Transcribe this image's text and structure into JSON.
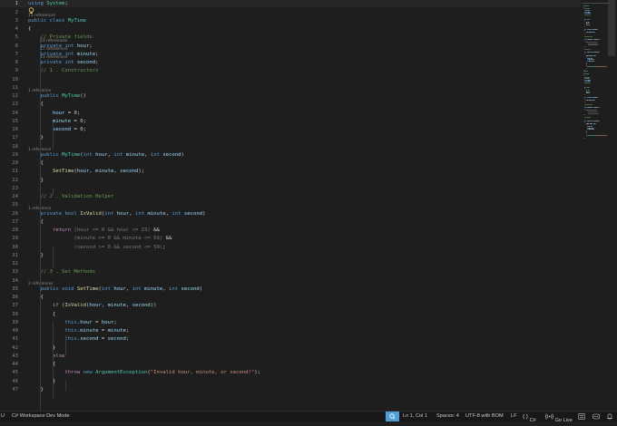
{
  "editor": {
    "lines": [
      {
        "n": "1",
        "ref": "",
        "tokens": [
          [
            "kw",
            "using "
          ],
          [
            "ty",
            "System"
          ],
          [
            "pl",
            ";"
          ]
        ]
      },
      {
        "n": "2",
        "ref": "11 references",
        "tokens": []
      },
      {
        "n": "3",
        "ref": "",
        "tokens": [
          [
            "kw",
            "public "
          ],
          [
            "kw",
            "class "
          ],
          [
            "ty",
            "MyTime"
          ]
        ]
      },
      {
        "n": "4",
        "ref": "",
        "tokens": [
          [
            "pl",
            "{"
          ]
        ]
      },
      {
        "n": "5",
        "ref": "23 references",
        "tokens": [
          [
            "pl",
            "    "
          ],
          [
            "cm",
            "// Private fields"
          ]
        ]
      },
      {
        "n": "6",
        "ref": "17 references",
        "tokens": [
          [
            "pl",
            "    "
          ],
          [
            "kw",
            "private "
          ],
          [
            "kw",
            "int "
          ],
          [
            "id",
            "hour"
          ],
          [
            "pl",
            ";"
          ]
        ]
      },
      {
        "n": "7",
        "ref": "11 references",
        "tokens": [
          [
            "pl",
            "    "
          ],
          [
            "kw",
            "private "
          ],
          [
            "kw",
            "int "
          ],
          [
            "id",
            "minute"
          ],
          [
            "pl",
            ";"
          ]
        ]
      },
      {
        "n": "8",
        "ref": "",
        "tokens": [
          [
            "pl",
            "    "
          ],
          [
            "kw",
            "private "
          ],
          [
            "kw",
            "int "
          ],
          [
            "id",
            "second"
          ],
          [
            "pl",
            ";"
          ]
        ]
      },
      {
        "n": "9",
        "ref": "",
        "tokens": [
          [
            "pl",
            "    "
          ],
          [
            "cm",
            "// 1 . Constructors"
          ]
        ]
      },
      {
        "n": "10",
        "ref": "",
        "tokens": []
      },
      {
        "n": "11",
        "ref": "1 reference",
        "tokens": []
      },
      {
        "n": "12",
        "ref": "",
        "tokens": [
          [
            "pl",
            "    "
          ],
          [
            "kw",
            "public "
          ],
          [
            "ty",
            "MyTime"
          ],
          [
            "pl",
            "()"
          ]
        ]
      },
      {
        "n": "13",
        "ref": "",
        "tokens": [
          [
            "pl",
            "    {"
          ]
        ]
      },
      {
        "n": "14",
        "ref": "",
        "tokens": [
          [
            "pl",
            "        "
          ],
          [
            "id",
            "hour"
          ],
          [
            "pl",
            " = "
          ],
          [
            "num",
            "0"
          ],
          [
            "pl",
            ";"
          ]
        ]
      },
      {
        "n": "15",
        "ref": "",
        "tokens": [
          [
            "pl",
            "        "
          ],
          [
            "id",
            "minute"
          ],
          [
            "pl",
            " = "
          ],
          [
            "num",
            "0"
          ],
          [
            "pl",
            ";"
          ]
        ]
      },
      {
        "n": "16",
        "ref": "",
        "tokens": [
          [
            "pl",
            "        "
          ],
          [
            "id",
            "second"
          ],
          [
            "pl",
            " = "
          ],
          [
            "num",
            "0"
          ],
          [
            "pl",
            ";"
          ]
        ]
      },
      {
        "n": "17",
        "ref": "",
        "tokens": [
          [
            "pl",
            "    }"
          ]
        ]
      },
      {
        "n": "18",
        "ref": "1 reference",
        "tokens": []
      },
      {
        "n": "19",
        "ref": "",
        "tokens": [
          [
            "pl",
            "    "
          ],
          [
            "kw",
            "public "
          ],
          [
            "ty",
            "MyTime"
          ],
          [
            "pl",
            "("
          ],
          [
            "kw",
            "int "
          ],
          [
            "id",
            "hour"
          ],
          [
            "pl",
            ", "
          ],
          [
            "kw",
            "int "
          ],
          [
            "id",
            "minute"
          ],
          [
            "pl",
            ", "
          ],
          [
            "kw",
            "int "
          ],
          [
            "id",
            "second"
          ],
          [
            "pl",
            ")"
          ]
        ]
      },
      {
        "n": "20",
        "ref": "",
        "tokens": [
          [
            "pl",
            "    {"
          ]
        ]
      },
      {
        "n": "21",
        "ref": "",
        "tokens": [
          [
            "pl",
            "        "
          ],
          [
            "fn",
            "SetTime"
          ],
          [
            "pl",
            "("
          ],
          [
            "id",
            "hour"
          ],
          [
            "pl",
            ", "
          ],
          [
            "id",
            "minute"
          ],
          [
            "pl",
            ", "
          ],
          [
            "id",
            "second"
          ],
          [
            "pl",
            ");"
          ]
        ]
      },
      {
        "n": "22",
        "ref": "",
        "tokens": [
          [
            "pl",
            "    }"
          ]
        ]
      },
      {
        "n": "23",
        "ref": "",
        "tokens": []
      },
      {
        "n": "24",
        "ref": "",
        "tokens": [
          [
            "pl",
            "    "
          ],
          [
            "cm",
            "// 2 . Validation Helper"
          ]
        ]
      },
      {
        "n": "25",
        "ref": "1 reference",
        "tokens": []
      },
      {
        "n": "26",
        "ref": "",
        "tokens": [
          [
            "pl",
            "    "
          ],
          [
            "kw",
            "private "
          ],
          [
            "kw",
            "bool "
          ],
          [
            "fn",
            "IsValid"
          ],
          [
            "pl",
            "("
          ],
          [
            "kw",
            "int "
          ],
          [
            "id",
            "hour"
          ],
          [
            "pl",
            ", "
          ],
          [
            "kw",
            "int "
          ],
          [
            "id",
            "minute"
          ],
          [
            "pl",
            ", "
          ],
          [
            "kw",
            "int "
          ],
          [
            "id",
            "second"
          ],
          [
            "pl",
            ")"
          ]
        ]
      },
      {
        "n": "27",
        "ref": "",
        "tokens": [
          [
            "pl",
            "    {"
          ]
        ]
      },
      {
        "n": "28",
        "ref": "",
        "tokens": [
          [
            "pl",
            "        "
          ],
          [
            "ctl",
            "return "
          ],
          [
            "dim",
            "(hour >= 0 && hour <= 23)"
          ],
          [
            "pl",
            " &&"
          ]
        ]
      },
      {
        "n": "29",
        "ref": "",
        "tokens": [
          [
            "pl",
            "               "
          ],
          [
            "dim",
            "(minute >= 0 && minute <= 59)"
          ],
          [
            "pl",
            " &&"
          ]
        ]
      },
      {
        "n": "30",
        "ref": "",
        "tokens": [
          [
            "pl",
            "               "
          ],
          [
            "dim",
            "(second >= 0 && second <= 59)"
          ],
          [
            "pl",
            ";"
          ]
        ]
      },
      {
        "n": "31",
        "ref": "",
        "tokens": [
          [
            "pl",
            "    }"
          ]
        ]
      },
      {
        "n": "32",
        "ref": "",
        "tokens": []
      },
      {
        "n": "33",
        "ref": "",
        "tokens": [
          [
            "pl",
            "    "
          ],
          [
            "cm",
            "// 3 . Set Methods"
          ]
        ]
      },
      {
        "n": "34",
        "ref": "2 references",
        "tokens": []
      },
      {
        "n": "35",
        "ref": "",
        "tokens": [
          [
            "pl",
            "    "
          ],
          [
            "kw",
            "public "
          ],
          [
            "kw",
            "void "
          ],
          [
            "fn",
            "SetTime"
          ],
          [
            "pl",
            "("
          ],
          [
            "kw",
            "int "
          ],
          [
            "id",
            "hour"
          ],
          [
            "pl",
            ", "
          ],
          [
            "kw",
            "int "
          ],
          [
            "id",
            "minute"
          ],
          [
            "pl",
            ", "
          ],
          [
            "kw",
            "int "
          ],
          [
            "id",
            "second"
          ],
          [
            "pl",
            ")"
          ]
        ]
      },
      {
        "n": "36",
        "ref": "",
        "tokens": [
          [
            "pl",
            "    {"
          ]
        ]
      },
      {
        "n": "37",
        "ref": "",
        "tokens": [
          [
            "pl",
            "        "
          ],
          [
            "ctl",
            "if "
          ],
          [
            "pl",
            "("
          ],
          [
            "fn",
            "IsValid"
          ],
          [
            "pl",
            "("
          ],
          [
            "id",
            "hour"
          ],
          [
            "pl",
            ", "
          ],
          [
            "id",
            "minute"
          ],
          [
            "pl",
            ", "
          ],
          [
            "id",
            "second"
          ],
          [
            "pl",
            "))"
          ]
        ]
      },
      {
        "n": "38",
        "ref": "",
        "tokens": [
          [
            "pl",
            "        {"
          ]
        ]
      },
      {
        "n": "39",
        "ref": "",
        "tokens": [
          [
            "pl",
            "            "
          ],
          [
            "kw",
            "this"
          ],
          [
            "pl",
            "."
          ],
          [
            "id",
            "hour"
          ],
          [
            "pl",
            " = "
          ],
          [
            "id",
            "hour"
          ],
          [
            "pl",
            ";"
          ]
        ]
      },
      {
        "n": "40",
        "ref": "",
        "tokens": [
          [
            "pl",
            "            "
          ],
          [
            "kw",
            "this"
          ],
          [
            "pl",
            "."
          ],
          [
            "id",
            "minute"
          ],
          [
            "pl",
            " = "
          ],
          [
            "id",
            "minute"
          ],
          [
            "pl",
            ";"
          ]
        ]
      },
      {
        "n": "41",
        "ref": "",
        "tokens": [
          [
            "pl",
            "            "
          ],
          [
            "kw",
            "this"
          ],
          [
            "pl",
            "."
          ],
          [
            "id",
            "second"
          ],
          [
            "pl",
            " = "
          ],
          [
            "id",
            "second"
          ],
          [
            "pl",
            ";"
          ]
        ]
      },
      {
        "n": "42",
        "ref": "",
        "tokens": [
          [
            "pl",
            "        }"
          ]
        ]
      },
      {
        "n": "43",
        "ref": "",
        "tokens": [
          [
            "pl",
            "        "
          ],
          [
            "ctl",
            "else"
          ]
        ]
      },
      {
        "n": "44",
        "ref": "",
        "tokens": [
          [
            "pl",
            "        {"
          ]
        ]
      },
      {
        "n": "45",
        "ref": "",
        "tokens": [
          [
            "pl",
            "            "
          ],
          [
            "ctl",
            "throw "
          ],
          [
            "kw",
            "new "
          ],
          [
            "ty",
            "ArgumentException"
          ],
          [
            "pl",
            "("
          ],
          [
            "str",
            "\"Invalid hour, minute, or second!\""
          ],
          [
            "pl",
            ");"
          ]
        ]
      },
      {
        "n": "46",
        "ref": "",
        "tokens": [
          [
            "pl",
            "        }"
          ]
        ]
      },
      {
        "n": "47",
        "ref": "",
        "tokens": [
          [
            "pl",
            "    }"
          ]
        ]
      }
    ]
  },
  "statusbar": {
    "left_truncated": "U",
    "workspace": "C# Workspace Dev Mode",
    "position": "Ln 1, Col 1",
    "spaces": "Spaces: 4",
    "encoding": "UTF-8 with BOM",
    "eol": "LF",
    "language": "C#",
    "golive": "Go Live"
  },
  "colors": {
    "background": "#1e1e1e",
    "keyword": "#569cd6",
    "type": "#4ec9b0",
    "function": "#dcdcaa",
    "identifier": "#9cdcfe",
    "comment": "#6a9955",
    "string": "#ce9178",
    "status_accent": "#4e9ed8"
  }
}
